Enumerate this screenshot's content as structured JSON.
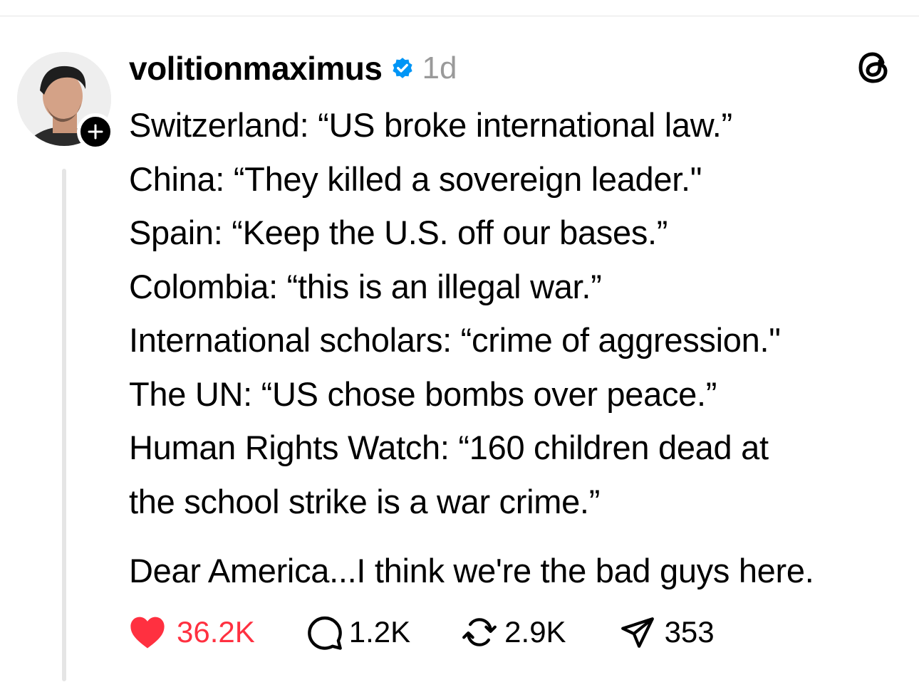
{
  "post": {
    "username": "volitionmaximus",
    "verified": true,
    "time": "1d",
    "lines": [
      "Switzerland: “US broke international law.”",
      "China: “They killed a sovereign leader.\"",
      "Spain: “Keep the U.S. off our bases.”",
      "Colombia: “this is an illegal war.”",
      "International scholars: “crime of aggression.\"",
      "The UN: “US chose bombs over peace.”",
      "Human Rights Watch: “160 children dead at",
      "the school strike is a war crime.”"
    ],
    "closing": "Dear America...I think we're the bad guys here."
  },
  "actions": {
    "likes": "36.2K",
    "replies": "1.2K",
    "reposts": "2.9K",
    "shares": "353"
  },
  "colors": {
    "like": "#ff3040",
    "verified": "#0095f6",
    "muted": "#9a9a9a",
    "thread_line": "#e5e5e5"
  },
  "icons": [
    "user-avatar",
    "follow-plus-icon",
    "verified-badge-icon",
    "threads-logo-icon",
    "heart-icon",
    "comment-icon",
    "repost-icon",
    "share-icon"
  ]
}
